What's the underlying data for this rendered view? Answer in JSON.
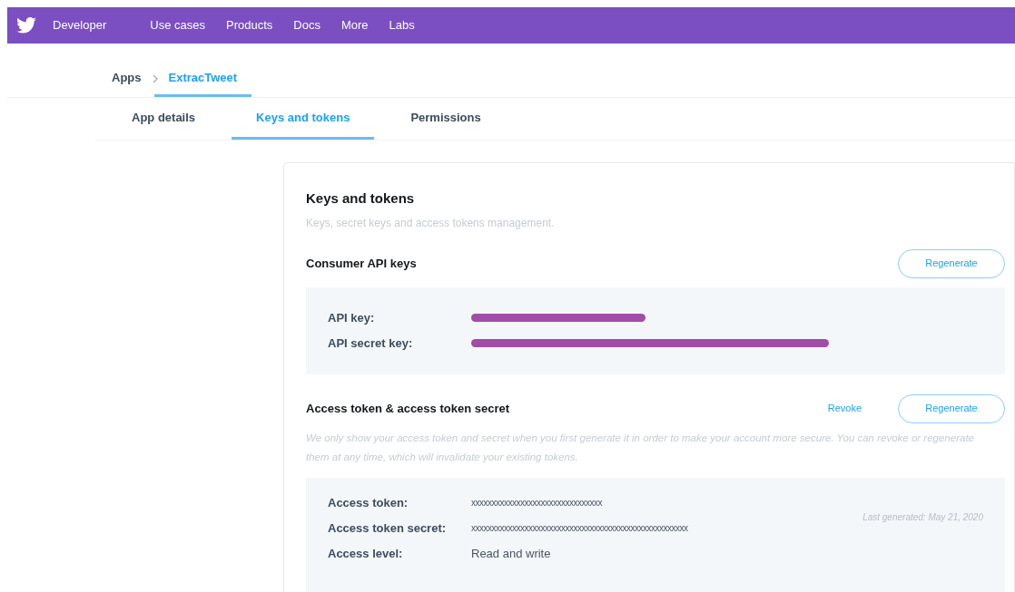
{
  "nav": {
    "brand": "Developer",
    "items": [
      "Use cases",
      "Products",
      "Docs",
      "More",
      "Labs"
    ]
  },
  "breadcrumb": {
    "root": "Apps",
    "current": "ExtracTweet"
  },
  "tabs": [
    {
      "label": "App details",
      "selected": false
    },
    {
      "label": "Keys and tokens",
      "selected": true
    },
    {
      "label": "Permissions",
      "selected": false
    }
  ],
  "card": {
    "title": "Keys and tokens",
    "subtitle": "Keys, secret keys and access tokens management.",
    "consumer": {
      "title": "Consumer API keys",
      "regenerate": "Regenerate",
      "rows": [
        {
          "label": "API key:",
          "kind": "redacted"
        },
        {
          "label": "API secret key:",
          "kind": "redacted"
        }
      ]
    },
    "access": {
      "title": "Access token & access token secret",
      "revoke": "Revoke",
      "regenerate": "Regenerate",
      "note": "We only show your access token and secret when you first generate it in order to make your account more secure. You can revoke or regenerate them at any time, which will invalidate your existing tokens.",
      "rows": [
        {
          "label": "Access token:",
          "kind": "text",
          "value": "xxxxxxxxxxxxxxxxxxxxxxxxxxxxxxxx"
        },
        {
          "label": "Access token secret:",
          "kind": "text",
          "value": "xxxxxxxxxxxxxxxxxxxxxxxxxxxxxxxxxxxxxxxxxxxxxxxxxxxxx"
        },
        {
          "label": "Access level:",
          "kind": "plain",
          "value": "Read and write"
        }
      ],
      "last_generated": "Last generated: May 21, 2020"
    }
  }
}
